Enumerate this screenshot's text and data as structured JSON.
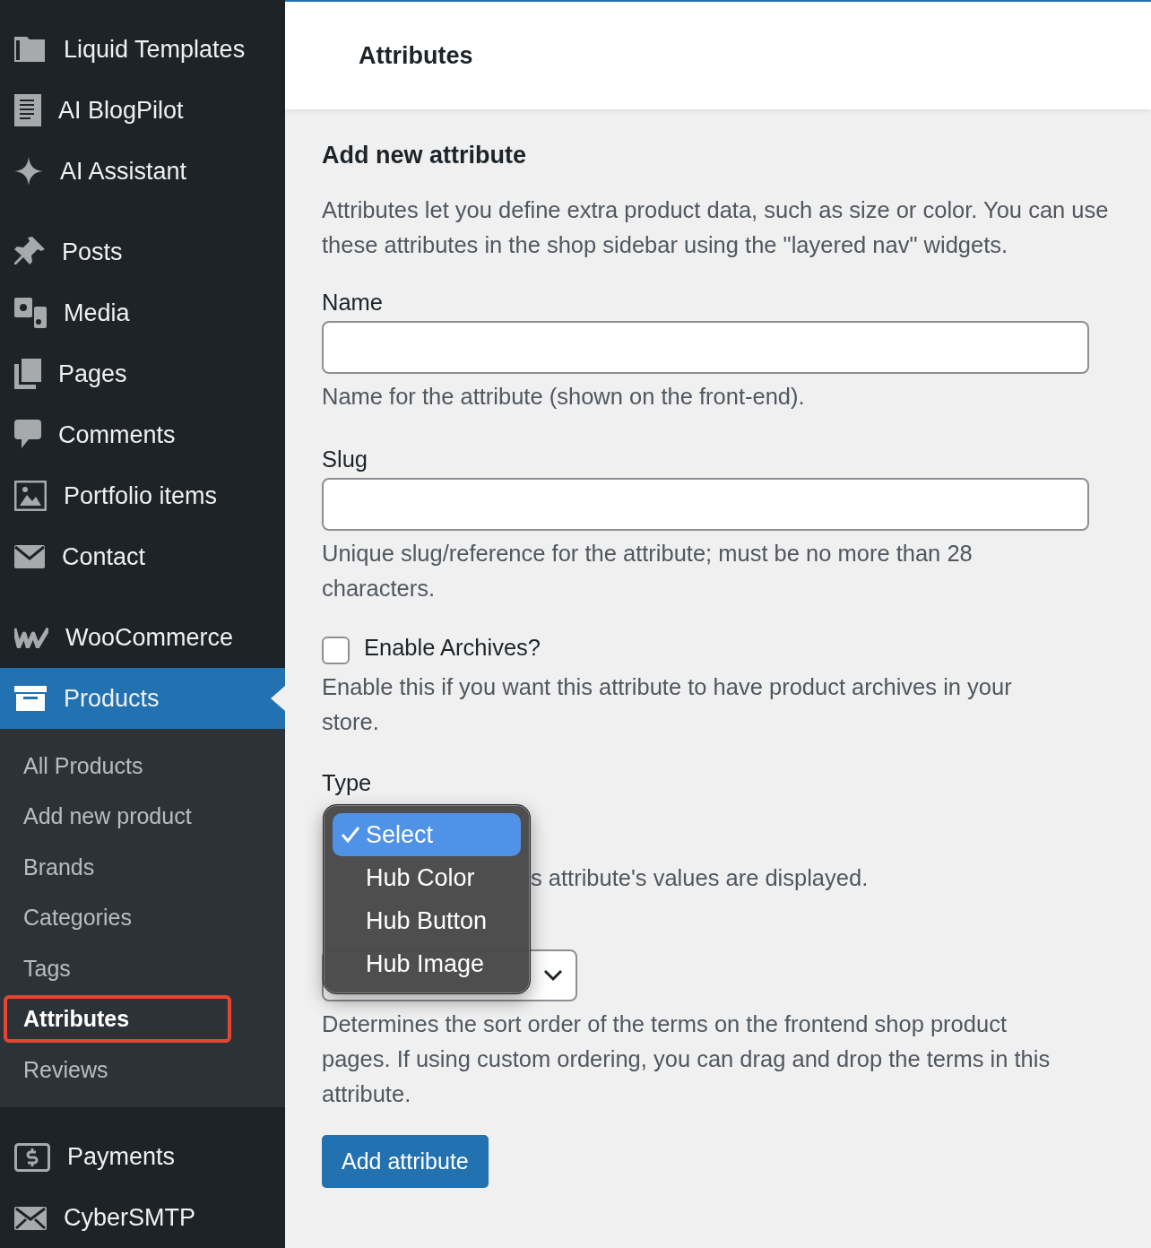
{
  "sidebar": {
    "items": [
      {
        "label": "Liquid Templates",
        "selected": false
      },
      {
        "label": "AI BlogPilot",
        "selected": false
      },
      {
        "label": "AI Assistant",
        "selected": false
      },
      {
        "label": "Posts",
        "selected": false
      },
      {
        "label": "Media",
        "selected": false
      },
      {
        "label": "Pages",
        "selected": false
      },
      {
        "label": "Comments",
        "selected": false
      },
      {
        "label": "Portfolio items",
        "selected": false
      },
      {
        "label": "Contact",
        "selected": false
      },
      {
        "label": "WooCommerce",
        "selected": false
      },
      {
        "label": "Products",
        "selected": true,
        "children": [
          {
            "label": "All Products",
            "selected": false,
            "highlighted": false
          },
          {
            "label": "Add new product",
            "selected": false,
            "highlighted": false
          },
          {
            "label": "Brands",
            "selected": false,
            "highlighted": false
          },
          {
            "label": "Categories",
            "selected": false,
            "highlighted": false
          },
          {
            "label": "Tags",
            "selected": false,
            "highlighted": false
          },
          {
            "label": "Attributes",
            "selected": true,
            "highlighted": true
          },
          {
            "label": "Reviews",
            "selected": false,
            "highlighted": false
          }
        ]
      },
      {
        "label": "Payments",
        "selected": false
      },
      {
        "label": "CyberSMTP",
        "selected": false
      }
    ]
  },
  "page_title": "Attributes",
  "form": {
    "heading": "Add new attribute",
    "intro": "Attributes let you define extra product data, such as size or color. You can use these attributes in the shop sidebar using the \"layered nav\" widgets.",
    "name": {
      "label": "Name",
      "hint": "Name for the attribute (shown on the front-end)."
    },
    "slug": {
      "label": "Slug",
      "hint": "Unique slug/reference for the attribute; must be no more than 28 characters."
    },
    "archives": {
      "label": "Enable Archives?",
      "checked": false,
      "hint": "Enable this if you want this attribute to have product archives in your store."
    },
    "type": {
      "label": "Type",
      "hint": "s attribute's values are displayed.",
      "options": [
        {
          "label": "Select",
          "selected": true
        },
        {
          "label": "Hub Color",
          "selected": false
        },
        {
          "label": "Hub Button",
          "selected": false
        },
        {
          "label": "Hub Image",
          "selected": false
        }
      ]
    },
    "sort": {
      "hint": "Determines the sort order of the terms on the frontend shop product pages. If using custom ordering, you can drag and drop the terms in this attribute."
    },
    "submit": "Add attribute"
  }
}
